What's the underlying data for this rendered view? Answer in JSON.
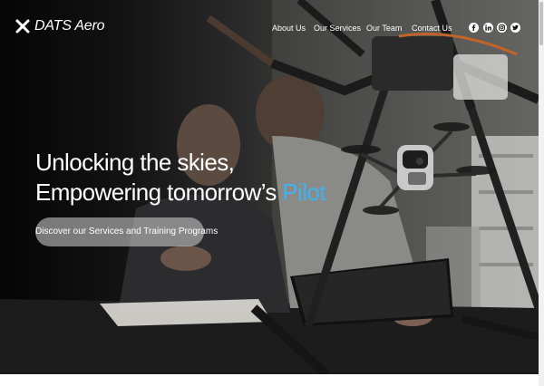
{
  "brand": {
    "name": "DATS Aero",
    "logo_icon": "drone-x-icon"
  },
  "nav": [
    {
      "label": "About Us"
    },
    {
      "label": "Our Services"
    },
    {
      "label": "Our Team"
    },
    {
      "label": "Contact Us"
    }
  ],
  "social": [
    {
      "name": "facebook-icon"
    },
    {
      "name": "linkedin-icon"
    },
    {
      "name": "instagram-icon"
    },
    {
      "name": "twitter-icon"
    }
  ],
  "hero": {
    "headline_line1": "Unlocking the skies,",
    "headline_line2_prefix": "Empowering tomorrow’s ",
    "headline_accent": "Pilot",
    "cta_label": "Discover our Services and Training Programs"
  },
  "colors": {
    "accent": "#41b2f0",
    "text": "#ffffff"
  }
}
